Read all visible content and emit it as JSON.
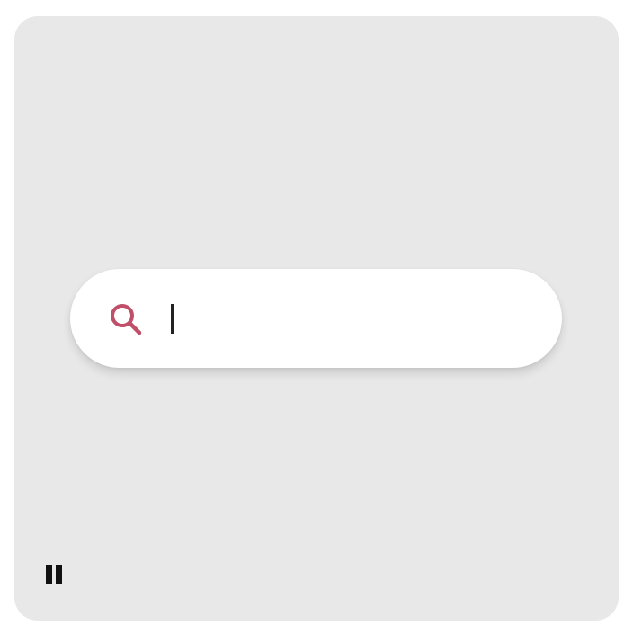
{
  "search": {
    "value": "",
    "placeholder": "",
    "icon": "search-icon",
    "icon_color": "#c0506a"
  },
  "controls": {
    "pause_icon": "pause-icon"
  },
  "colors": {
    "panel_background": "#e8e8e8",
    "search_background": "#ffffff",
    "caret": "#222222"
  }
}
